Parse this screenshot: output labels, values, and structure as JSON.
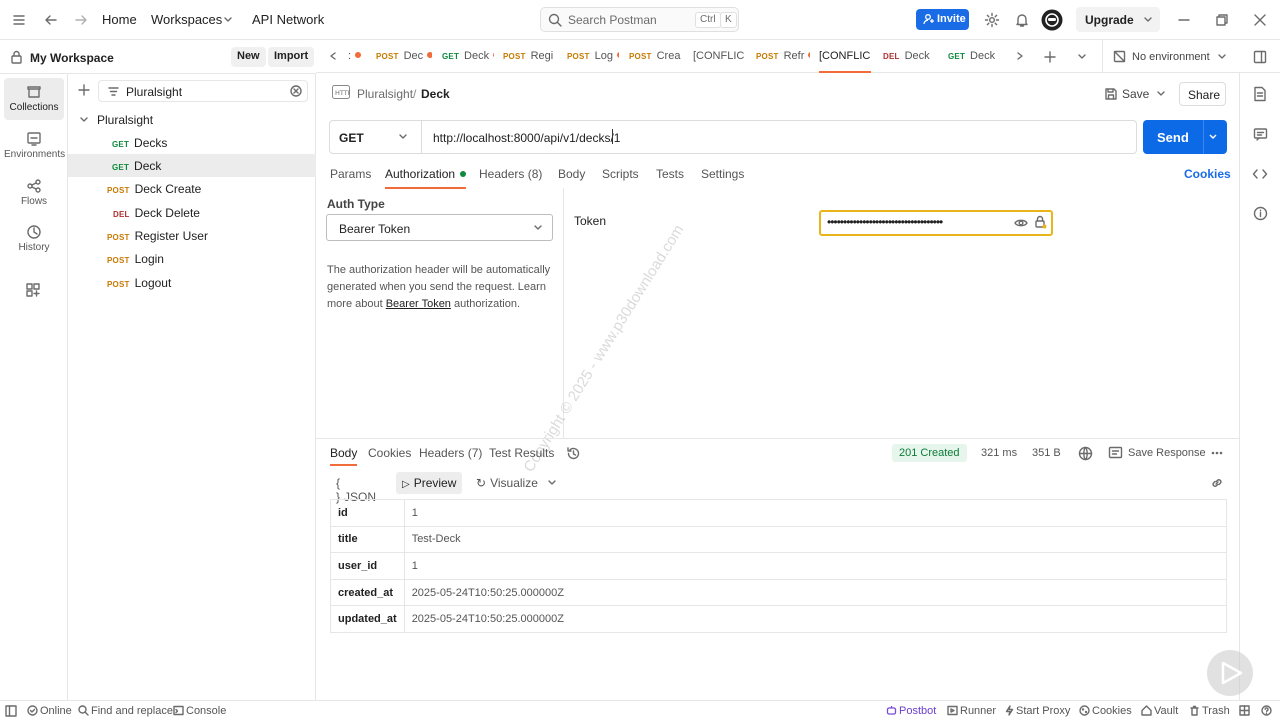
{
  "topbar": {
    "home": "Home",
    "workspaces": "Workspaces",
    "api_network": "API Network",
    "search_placeholder": "Search Postman",
    "kbd_ctrl": "Ctrl",
    "kbd_k": "K",
    "invite": "Invite",
    "upgrade": "Upgrade"
  },
  "workspace": {
    "name": "My Workspace",
    "new": "New",
    "import": "Import"
  },
  "rail": [
    {
      "label": "Collections",
      "icon": "collections-icon"
    },
    {
      "label": "Environments",
      "icon": "environments-icon"
    },
    {
      "label": "Flows",
      "icon": "flows-icon"
    },
    {
      "label": "History",
      "icon": "history-icon"
    }
  ],
  "tree": {
    "filter": "Pluralsight",
    "collection": "Pluralsight",
    "items": [
      {
        "method": "GET",
        "name": "Decks"
      },
      {
        "method": "GET",
        "name": "Deck"
      },
      {
        "method": "POST",
        "name": "Deck Create"
      },
      {
        "method": "DEL",
        "name": "Deck Delete"
      },
      {
        "method": "POST",
        "name": "Register User"
      },
      {
        "method": "POST",
        "name": "Login"
      },
      {
        "method": "POST",
        "name": "Logout"
      }
    ]
  },
  "tabs": [
    {
      "method": "",
      "name": ":"
    },
    {
      "method": "POST",
      "name": "Dec"
    },
    {
      "method": "GET",
      "name": "Deck"
    },
    {
      "method": "POST",
      "name": "Regi"
    },
    {
      "method": "POST",
      "name": "Log"
    },
    {
      "method": "POST",
      "name": "Crea"
    },
    {
      "method": "",
      "name": "[CONFLIC"
    },
    {
      "method": "POST",
      "name": "Refr"
    },
    {
      "method": "",
      "name": "[CONFLIC"
    },
    {
      "method": "DEL",
      "name": "Deck"
    },
    {
      "method": "GET",
      "name": "Deck"
    }
  ],
  "environment": "No environment",
  "request": {
    "breadcrumb_parent": "Pluralsight",
    "breadcrumb_sep": "/",
    "breadcrumb_current": "Deck",
    "save": "Save",
    "share": "Share",
    "method": "GET",
    "url": "http://localhost:8000/api/v1/decks/1",
    "send": "Send",
    "subtabs": [
      "Params",
      "Authorization",
      "Headers (8)",
      "Body",
      "Scripts",
      "Tests",
      "Settings"
    ],
    "cookies": "Cookies"
  },
  "auth": {
    "type_label": "Auth Type",
    "type_value": "Bearer Token",
    "desc_1": "The authorization header will be automatically generated when you send the request. Learn more about ",
    "desc_link": "Bearer Token",
    "desc_2": " authorization.",
    "token_label": "Token",
    "token_value": "••••••••••••••••••••••••••••••••••••"
  },
  "watermark": "Copyright © 2025 - www.p30download.com",
  "response": {
    "tabs": [
      "Body",
      "Cookies",
      "Headers (7)",
      "Test Results"
    ],
    "status": "201 Created",
    "time": "321 ms",
    "size": "351 B",
    "save_response": "Save Response",
    "formats": [
      "JSON",
      "Preview",
      "Visualize"
    ],
    "rows": [
      {
        "key": "id",
        "value": "1"
      },
      {
        "key": "title",
        "value": "Test-Deck"
      },
      {
        "key": "user_id",
        "value": "1"
      },
      {
        "key": "created_at",
        "value": "2025-05-24T10:50:25.000000Z"
      },
      {
        "key": "updated_at",
        "value": "2025-05-24T10:50:25.000000Z"
      }
    ]
  },
  "footer": {
    "online": "Online",
    "find": "Find and replace",
    "console": "Console",
    "postbot": "Postbot",
    "runner": "Runner",
    "proxy": "Start Proxy",
    "cookies": "Cookies",
    "vault": "Vault",
    "trash": "Trash"
  },
  "colors": {
    "accent": "#f26b3a",
    "primary": "#0d6ae6",
    "get": "#0c8a3d",
    "post": "#c77a00",
    "del": "#b03030"
  }
}
